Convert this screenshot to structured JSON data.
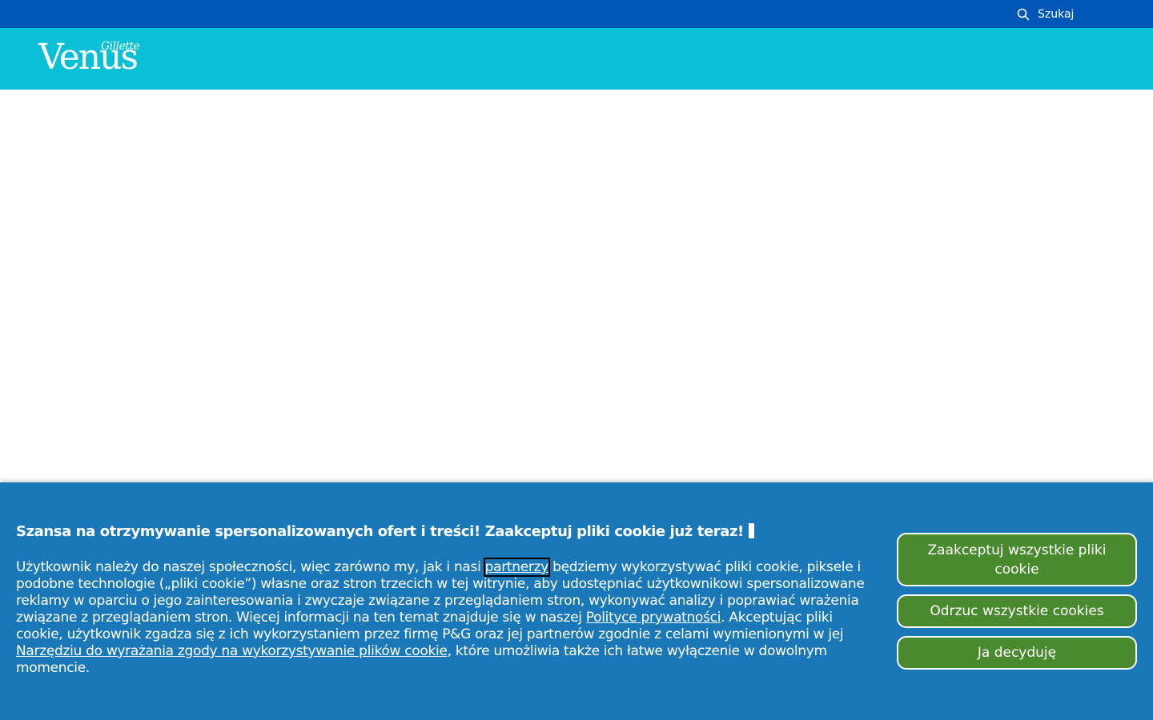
{
  "topbar": {
    "search_label": "Szukaj",
    "search_icon": "search-icon"
  },
  "header": {
    "logo_small": "Gillette",
    "logo_main": "Venus"
  },
  "cookie_banner": {
    "title": "Szansa na otrzymywanie spersonalizowanych ofert i treści! Zaakceptuj pliki cookie już teraz!",
    "text_part1": "Użytkownik należy do naszej społeczności, więc zarówno my, jak i nasi ",
    "partners_link": "partnerzy",
    "text_part2": " będziemy wykorzystywać pliki cookie, piksele i podobne technologie („pliki cookie”) własne oraz stron trzecich w tej witrynie, aby udostępniać użytkownikowi spersonalizowane reklamy w oparciu o jego zainteresowania i zwyczaje związane z przeglądaniem stron, wykonywać analizy i poprawiać wrażenia związane z przeglądaniem stron. Więcej informacji na ten temat znajduje się w naszej ",
    "privacy_link": "Polityce prywatności",
    "text_part3": ". Akceptując pliki cookie, użytkownik zgadza się z ich wykorzystaniem przez firmę P&G oraz jej partnerów zgodnie z celami wymienionymi w jej ",
    "consent_tool_link": "Narzędziu do wyrażania zgody na wykorzystywanie plików cookie",
    "text_part4": ", które umożliwia także ich łatwe wyłączenie w dowolnym momencie.",
    "accept_all_label": "Zaakceptuj wszystkie pliki cookie",
    "reject_all_label": "Odrzuc wszystkie cookies",
    "decide_label": "Ja decyduję"
  },
  "colors": {
    "topbar": "#0057b8",
    "header": "#0ac0d6",
    "cookie_banner": "#1a78b8",
    "button": "#4a8a2e"
  }
}
